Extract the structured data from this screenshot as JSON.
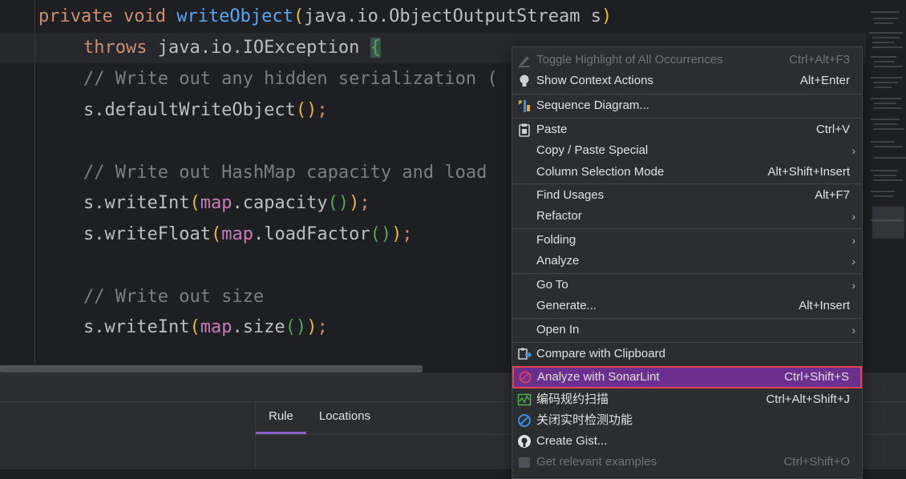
{
  "editor": {
    "lines": {
      "l1": {
        "kw1": "private",
        "kw2": "void",
        "fn": "writeObject",
        "open": "(",
        "type": "java.io.ObjectOutputStream",
        "param": " s",
        "close": ")"
      },
      "l2": {
        "kw": "throws",
        "type": " java.io.IOException ",
        "brace": "{"
      },
      "l3": {
        "comment": "// Write out any hidden serialization ("
      },
      "l4": {
        "call": "s.defaultWriteObject",
        "parens": "()",
        "semi": ";"
      },
      "l5": {
        "comment": "// Write out HashMap capacity and load"
      },
      "l6": {
        "call": "s.writeInt",
        "open": "(",
        "field": "map",
        "call2": ".capacity",
        "inner": "()",
        "close": ")",
        "semi": ";"
      },
      "l7": {
        "call": "s.writeFloat",
        "open": "(",
        "field": "map",
        "call2": ".loadFactor",
        "inner": "()",
        "close": ")",
        "semi": ";"
      },
      "l8": {
        "comment": "// Write out size"
      },
      "l9": {
        "call": "s.writeInt",
        "open": "(",
        "field": "map",
        "call2": ".size",
        "inner": "()",
        "close": ")",
        "semi": ";"
      }
    }
  },
  "bottom_panel": {
    "tabs": [
      {
        "label": "Rule",
        "active": true
      },
      {
        "label": "Locations",
        "active": false
      }
    ]
  },
  "context_menu": {
    "items": [
      {
        "label": "Toggle Highlight of All Occurrences",
        "shortcut": "Ctrl+Alt+F3",
        "icon": "highlighter-icon",
        "disabled": true
      },
      {
        "label": "Show Context Actions",
        "shortcut": "Alt+Enter",
        "icon": "lightbulb-icon"
      },
      {
        "label": "Sequence Diagram...",
        "shortcut": "",
        "icon": "sequence-diagram-icon"
      },
      {
        "label": "Paste",
        "shortcut": "Ctrl+V",
        "icon": "clipboard-icon"
      },
      {
        "label": "Copy / Paste Special",
        "shortcut": "",
        "submenu": true
      },
      {
        "label": "Column Selection Mode",
        "shortcut": "Alt+Shift+Insert"
      },
      {
        "label": "Find Usages",
        "shortcut": "Alt+F7"
      },
      {
        "label": "Refactor",
        "shortcut": "",
        "submenu": true
      },
      {
        "label": "Folding",
        "shortcut": "",
        "submenu": true
      },
      {
        "label": "Analyze",
        "shortcut": "",
        "submenu": true
      },
      {
        "label": "Go To",
        "shortcut": "",
        "submenu": true
      },
      {
        "label": "Generate...",
        "shortcut": "Alt+Insert"
      },
      {
        "label": "Open In",
        "shortcut": "",
        "submenu": true
      },
      {
        "label": "Compare with Clipboard",
        "shortcut": "",
        "icon": "compare-icon"
      },
      {
        "label": "Analyze with SonarLint",
        "shortcut": "Ctrl+Shift+S",
        "icon": "sonarlint-icon",
        "selected": true
      },
      {
        "label": "编码规约扫描",
        "shortcut": "Ctrl+Alt+Shift+J",
        "icon": "scan-icon"
      },
      {
        "label": "关闭实时检测功能",
        "shortcut": "",
        "icon": "stop-icon"
      },
      {
        "label": "Create Gist...",
        "shortcut": "",
        "icon": "github-icon"
      },
      {
        "label": "Get relevant examples",
        "shortcut": "Ctrl+Shift+O",
        "icon": "examples-icon",
        "disabled": true
      }
    ]
  },
  "colors": {
    "editor_bg": "#1e1f22",
    "keyword": "#cf8e6d",
    "function": "#56a8f5",
    "field": "#c77dbb",
    "comment": "#7a7e85",
    "menu_bg": "#2b2d30",
    "selection": "#6b2f8f",
    "highlight_border": "#e5434b",
    "tab_underline": "#8c5fc5"
  }
}
